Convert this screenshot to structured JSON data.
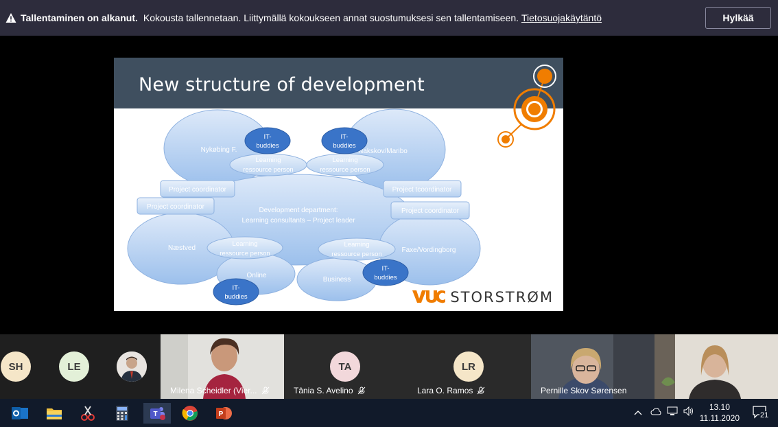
{
  "banner": {
    "title": "Tallentaminen on alkanut.",
    "message": "Kokousta tallennetaan. Liittymällä kokoukseen annat suostumuksesi sen tallentamiseen.",
    "link": "Tietosuojakäytäntö",
    "reject_button": "Hylkää"
  },
  "slide": {
    "title": "New structure of development",
    "brand": "STORSTRØM",
    "labels": {
      "nykobing": "Nykøbing F.",
      "nakskov": "Nakskov/Maribo",
      "naestved": "Næstved",
      "faxe": "Faxe/Vordingborg",
      "online": "Online",
      "business": "Business",
      "dev_line1": "Development department:",
      "dev_line2": "Learning consultants – Project leader",
      "it1": "IT-",
      "it2": "buddies",
      "lrp1": "Learning",
      "lrp2": "ressource person",
      "pc1": "Project coordinator",
      "pc2": "Project coordinator",
      "pc3": "Project tcoordinator",
      "pc4": "Project coordinator"
    }
  },
  "participants": [
    {
      "initials": "SH"
    },
    {
      "initials": "LE"
    },
    {
      "name": "Milena Scheidler (Vier..."
    },
    {
      "initials": "TA",
      "name": "Tânia S. Avelino"
    },
    {
      "initials": "LR",
      "name": "Lara O. Ramos"
    },
    {
      "name": "Pernille Skov Sørensen"
    }
  ],
  "taskbar": {
    "time": "13.10",
    "date": "11.11.2020",
    "notifications": "21"
  },
  "colors": {
    "banner_bg": "#2d2c3c",
    "slide_header": "#3f4f5f",
    "accent_orange": "#f07d00",
    "bubble_light": "#c9dcf5",
    "bubble_dark": "#3a74c8"
  }
}
